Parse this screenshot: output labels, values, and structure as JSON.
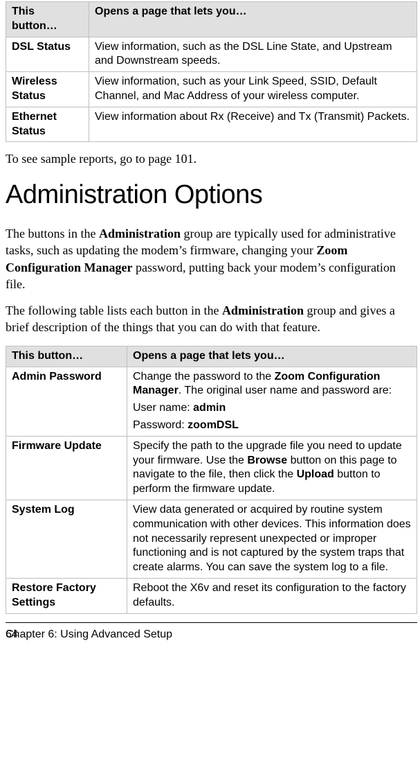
{
  "table1": {
    "head_button": "This button…",
    "head_desc": "Opens a page that lets you…",
    "rows": [
      {
        "name": "DSL Status",
        "desc": "View information, such as the DSL Line State, and Upstream and Downstream speeds."
      },
      {
        "name": "Wireless Status",
        "desc": "View information, such as your Link Speed, SSID, Default Channel, and Mac Address of your wireless computer."
      },
      {
        "name": "Ethernet Status",
        "desc": "View information about Rx (Receive) and Tx (Transmit) Packets."
      }
    ]
  },
  "para_sample": "To see sample reports, go to page 101.",
  "heading": "Administration Options",
  "para_intro": {
    "p1a": "The buttons in the ",
    "p1b": "Administration",
    "p1c": " group are typically used for administrative tasks, such as updating the modem’s firmware, changing your ",
    "p1d": "Zoom Configuration Manager",
    "p1e": " password, putting back your modem’s configuration file."
  },
  "para_table_lead": {
    "p2a": "The following table lists each button in the ",
    "p2b": "Administration",
    "p2c": " group and gives a brief description of the things that you can do with that feature."
  },
  "table2": {
    "head_button": "This button…",
    "head_desc": "Opens a page that lets you…",
    "row1": {
      "name": "Admin Password",
      "d1a": "Change the password to the ",
      "d1b": "Zoom Configuration Manager",
      "d1c": ". The original user name and password are:",
      "d2a": "User name: ",
      "d2b": "admin",
      "d3a": "Password: ",
      "d3b": "zoomDSL"
    },
    "row2": {
      "name": "Firmware Update",
      "da": "Specify the path to the upgrade file you need to update your firmware. Use the ",
      "db": "Browse",
      "dc": " button on this page to navigate to the file, then click the ",
      "dd": "Upload",
      "de": " button to perform the firmware update."
    },
    "row3": {
      "name": "System Log",
      "desc": "View data generated or acquired by routine system communication with other devices. This information does not necessarily represent unexpected or improper functioning and is not captured by the system traps that create alarms. You can save the system log to a file."
    },
    "row4": {
      "name": "Restore Factory Settings",
      "da": "Reboot the ",
      "db": "X6v",
      "dc": " and reset its configuration to the factory defaults."
    }
  },
  "footer": "Chapter 6: Using Advanced Setup",
  "page_num": "64"
}
